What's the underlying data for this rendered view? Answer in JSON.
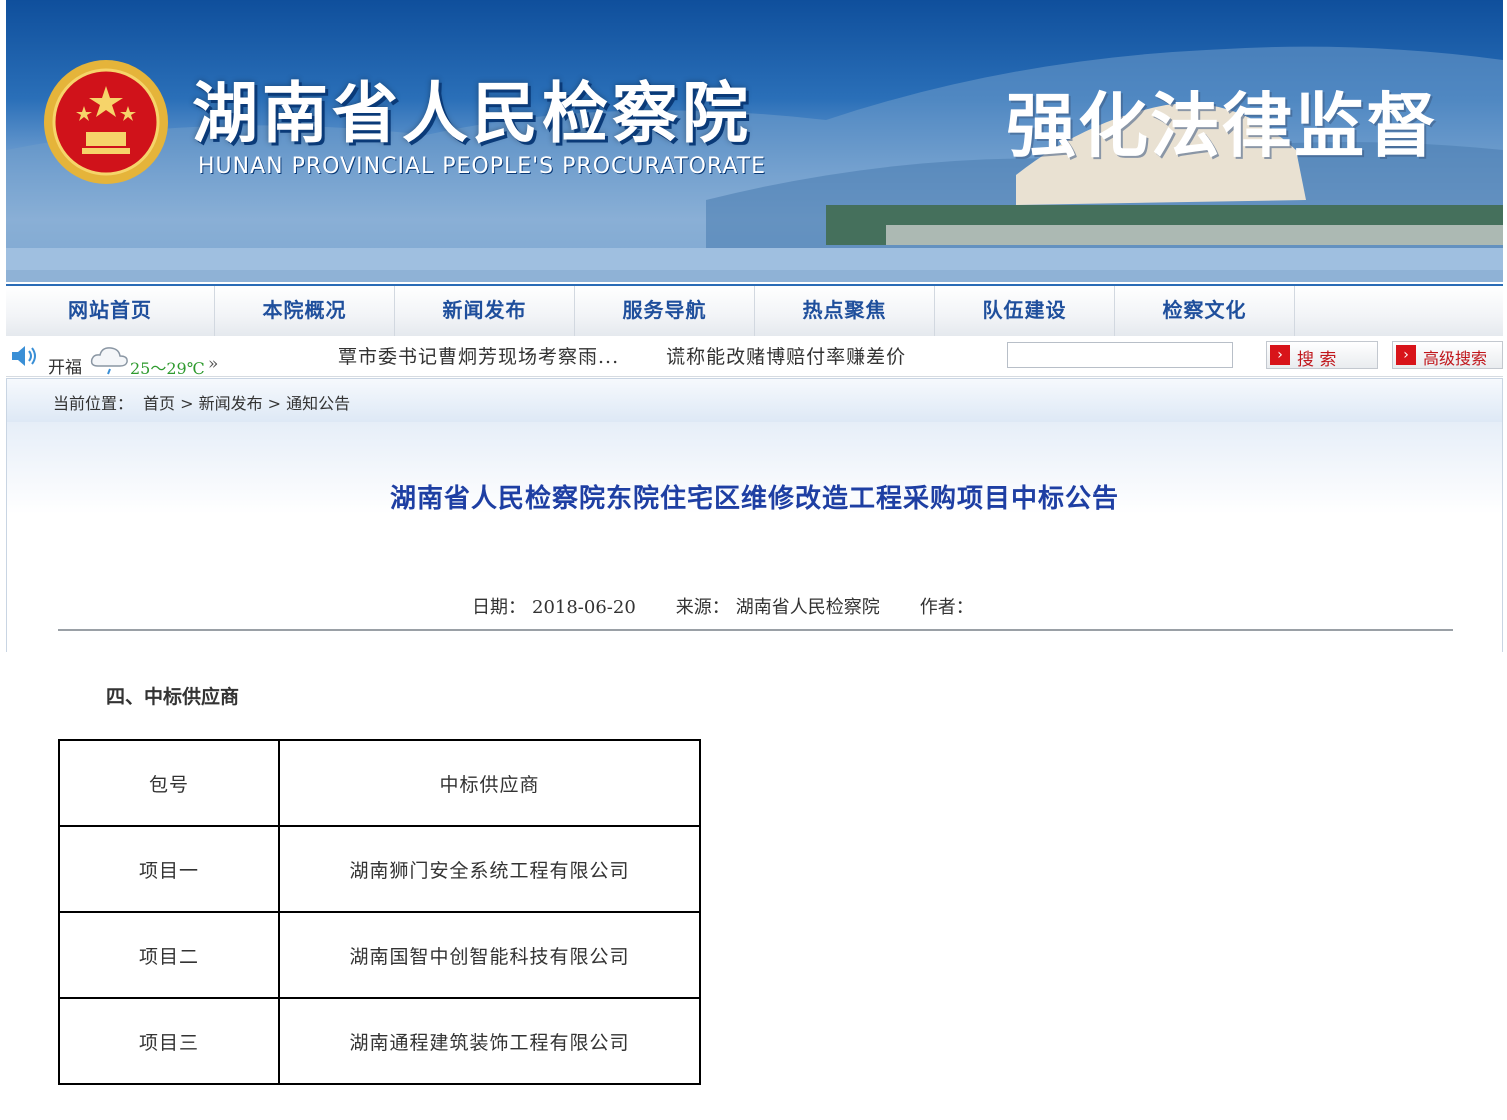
{
  "banner": {
    "title": "湖南省人民检察院",
    "title_en": "HUNAN PROVINCIAL PEOPLE'S PROCURATORATE",
    "slogan": "强化法律监督",
    "emblem_icon": "procuratorate-emblem-icon",
    "colors": {
      "sky_top": "#0f4f9c",
      "accent": "#1f4f9c"
    }
  },
  "nav": {
    "items": [
      {
        "label": "网站首页"
      },
      {
        "label": "本院概况"
      },
      {
        "label": "新闻发布"
      },
      {
        "label": "服务导航"
      },
      {
        "label": "热点聚焦"
      },
      {
        "label": "队伍建设"
      },
      {
        "label": "检察文化"
      }
    ]
  },
  "infobar": {
    "weather_city": "开福",
    "weather_temp": "25～29℃",
    "weather_more": "»",
    "ticker": [
      "覃市委书记曹炯芳现场考察雨...",
      "谎称能改赌博赔付率赚差价"
    ],
    "search_placeholder": "",
    "search_button": "搜 索",
    "advanced_search_button": "高级搜索"
  },
  "breadcrumb": {
    "label": "当前位置：",
    "path": "首页 > 新闻发布 > 通知公告"
  },
  "article": {
    "title": "湖南省人民检察院东院住宅区维修改造工程采购项目中标公告",
    "date_label": "日期：",
    "date": "2018-06-20",
    "source_label": "来源：",
    "source": "湖南省人民检察院",
    "author_label": "作者：",
    "author": "",
    "section_heading": "四、中标供应商",
    "table": {
      "headers": [
        "包号",
        "中标供应商"
      ],
      "rows": [
        [
          "项目一",
          "湖南狮门安全系统工程有限公司"
        ],
        [
          "项目二",
          "湖南国智中创智能科技有限公司"
        ],
        [
          "项目三",
          "湖南通程建筑装饰工程有限公司"
        ]
      ]
    }
  }
}
